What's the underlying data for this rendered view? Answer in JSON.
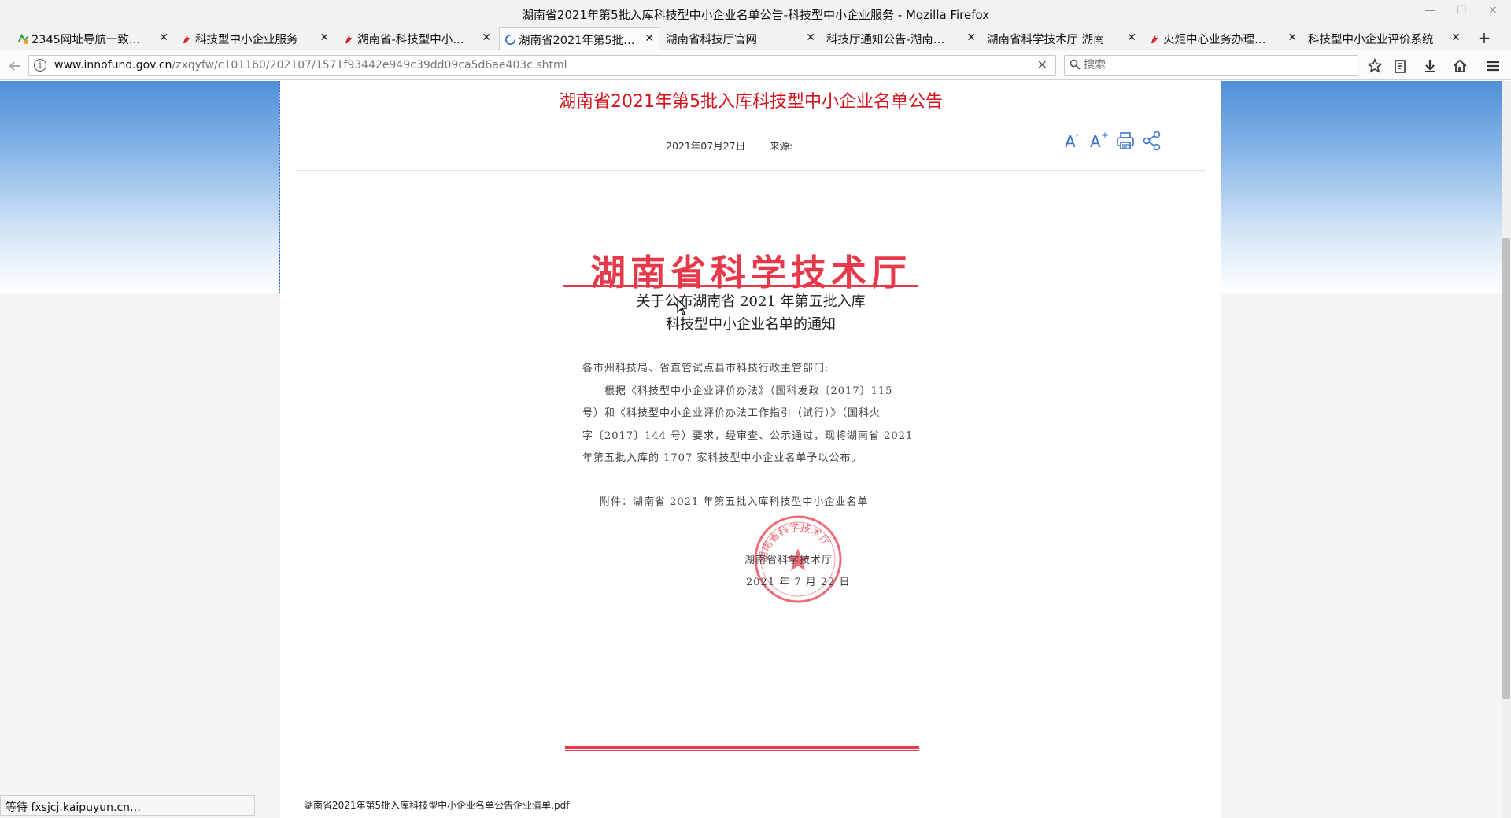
{
  "window": {
    "title": "湖南省2021年第5批入库科技型中小企业名单公告-科技型中小企业服务 - Mozilla Firefox",
    "controls": [
      "—",
      "❐",
      "✕"
    ]
  },
  "tabs": [
    {
      "label": "2345网址导航一致…",
      "icon": "2345-site-icon"
    },
    {
      "label": "科技型中小企业服务",
      "icon": "torch-logo-icon"
    },
    {
      "label": "湖南省-科技型中小…",
      "icon": "torch-logo-icon"
    },
    {
      "label": "湖南省2021年第5批…",
      "icon": "loading-spinner-icon"
    },
    {
      "label": "湖南省科技厅官网",
      "icon": ""
    },
    {
      "label": "科技厅通知公告-湖南…",
      "icon": ""
    },
    {
      "label": "湖南省科学技术厅 湖南…",
      "icon": ""
    },
    {
      "label": "火炬中心业务办理…",
      "icon": "torch-logo-icon"
    },
    {
      "label": "科技型中小企业评价系统",
      "icon": ""
    }
  ],
  "nav": {
    "url_host": "www.innofund.gov.cn",
    "url_path": "/zxqyfw/c101160/202107/1571f93442e949c39dd09ca5d6ae403c.shtml",
    "search_placeholder": "搜索"
  },
  "article": {
    "title": "湖南省2021年第5批入库科技型中小企业名单公告",
    "date": "2021年07月27日",
    "source_label": "来源:"
  },
  "document": {
    "header": "湖南省科学技术厅",
    "subtitle_line1": "关于公布湖南省 2021 年第五批入库",
    "subtitle_line2": "科技型中小企业名单的通知",
    "addressee": "各市州科技局、省直管试点县市科技行政主管部门:",
    "body_lines": [
      "　　根据《科技型中小企业评价办法》（国科发政〔2017〕115",
      "号）和《科技型中小企业评价办法工作指引（试行）》（国科火",
      "字〔2017〕144 号）要求，经审查、公示通过，现将湖南省 2021",
      "年第五批入库的 1707 家科技型中小企业名单予以公布。"
    ],
    "attachment_line": "附件：湖南省 2021 年第五批入库科技型中小企业名单",
    "signature_org": "湖南省科学技术厅",
    "signature_date": "2021 年 7 月 22 日",
    "stamp_text": "湖南省科学技术厅"
  },
  "attachment_file": "湖南省2021年第5批入库科技型中小企业名单公告企业清单.pdf",
  "status_text": "等待 fxsjcj.kaipuyun.cn…",
  "colors": {
    "title_red": "#d4121c",
    "doc_red": "#e8394a",
    "tool_blue": "#3a73c8"
  }
}
